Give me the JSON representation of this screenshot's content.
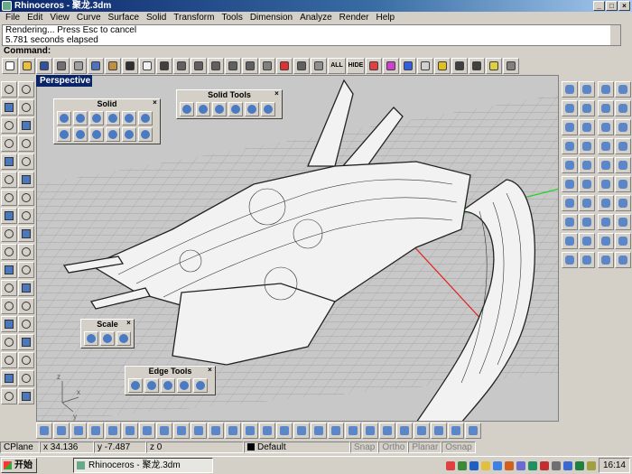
{
  "window": {
    "title": "Rhinoceros - 聚龙.3dm",
    "controls": [
      "_",
      "□",
      "×"
    ]
  },
  "menu": [
    "File",
    "Edit",
    "View",
    "Curve",
    "Surface",
    "Solid",
    "Transform",
    "Tools",
    "Dimension",
    "Analyze",
    "Render",
    "Help"
  ],
  "command_history": [
    "Rendering... Press Esc to cancel",
    "5.781 seconds elapsed"
  ],
  "command_prompt": "Command:",
  "toolbar_top": [
    {
      "icon": "new-icon",
      "color": "#ffffff"
    },
    {
      "icon": "open-icon",
      "color": "#e8c040"
    },
    {
      "icon": "save-icon",
      "color": "#3050a0"
    },
    {
      "icon": "print-icon",
      "color": "#707070"
    },
    {
      "icon": "cut-icon",
      "color": "#a0a0a0"
    },
    {
      "icon": "copy-icon",
      "color": "#5070c0"
    },
    {
      "icon": "paste-icon",
      "color": "#c09040"
    },
    {
      "icon": "undo-icon",
      "color": "#303030"
    },
    {
      "icon": "pan-icon",
      "color": "#f0f0f0"
    },
    {
      "icon": "rotate-view-icon",
      "color": "#404040"
    },
    {
      "icon": "zoom-icon",
      "color": "#606060"
    },
    {
      "icon": "zoom-window-icon",
      "color": "#606060"
    },
    {
      "icon": "zoom-extents-icon",
      "color": "#606060"
    },
    {
      "icon": "zoom-selected-icon",
      "color": "#606060"
    },
    {
      "icon": "undo-view-icon",
      "color": "#606060"
    },
    {
      "icon": "four-viewports-icon",
      "color": "#808080"
    },
    {
      "icon": "car-icon",
      "color": "#e03030"
    },
    {
      "icon": "lock-icon",
      "color": "#606060"
    },
    {
      "icon": "show-icon",
      "color": "#909090"
    },
    {
      "icon": "all-icon",
      "color": "#909090",
      "label": "ALL"
    },
    {
      "icon": "hide-icon",
      "color": "#909090",
      "label": "HIDE"
    },
    {
      "icon": "layers-icon",
      "color": "#e04040"
    },
    {
      "icon": "color-wheel-icon",
      "color": "#d040d0"
    },
    {
      "icon": "render-sphere-icon",
      "color": "#3060e0"
    },
    {
      "icon": "material-sphere-icon",
      "color": "#d0d0d0"
    },
    {
      "icon": "light-icon",
      "color": "#e0c020"
    },
    {
      "icon": "dimension-icon",
      "color": "#404040"
    },
    {
      "icon": "point-icon",
      "color": "#404040"
    },
    {
      "icon": "help-icon",
      "color": "#e0d040"
    },
    {
      "icon": "tools-icon",
      "color": "#808080"
    }
  ],
  "viewport": {
    "label": "Perspective",
    "axis_labels": [
      "x",
      "y",
      "z"
    ]
  },
  "panels": {
    "solid": {
      "title": "Solid",
      "close": "×"
    },
    "solid_tools": {
      "title": "Solid Tools",
      "close": "×"
    },
    "scale": {
      "title": "Scale",
      "close": "×"
    },
    "edge_tools": {
      "title": "Edge Tools",
      "close": "×"
    }
  },
  "status_bar": {
    "cplane": "CPlane",
    "x": "x 34.136",
    "y": "y -7.487",
    "z": "z 0",
    "layer": "Default",
    "toggles": [
      "Snap",
      "Ortho",
      "Planar",
      "Osnap"
    ]
  },
  "taskbar": {
    "start": "开始",
    "task": "Rhinoceros - 聚龙.3dm",
    "clock": "16:14",
    "tray_colors": [
      "#e04040",
      "#3a8a3a",
      "#2060c0",
      "#e0c040",
      "#4080e0",
      "#d06020",
      "#6a6ad0",
      "#209060",
      "#c03030",
      "#707070",
      "#3a6ad0",
      "#208040",
      "#a0a040"
    ]
  },
  "colors": {
    "title_bar": "#0a246a",
    "viewport_bg": "#c8c8c8",
    "grid": "#9a9a9a",
    "x_axis": "#e02020",
    "y_axis": "#20d020"
  }
}
